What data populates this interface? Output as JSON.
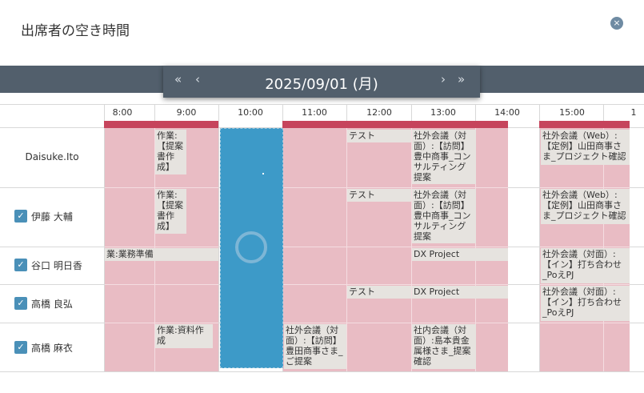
{
  "dialog": {
    "title": "出席者の空き時間",
    "close_icon": "×"
  },
  "nav": {
    "prev_week": "«",
    "prev_day": "‹",
    "date": "2025/09/01 (月)",
    "next_day": "›",
    "next_week": "»"
  },
  "times": [
    "8:00",
    "9:00",
    "10:00",
    "11:00",
    "12:00",
    "13:00",
    "14:00",
    "15:00",
    "1"
  ],
  "members": [
    {
      "name": "Daisuke.Ito",
      "checked": false
    },
    {
      "name": "伊藤 大輔",
      "checked": true
    },
    {
      "name": "谷口 明日香",
      "checked": true
    },
    {
      "name": "高橋 良弘",
      "checked": true
    },
    {
      "name": "高橋 麻衣",
      "checked": true
    }
  ],
  "check_mark": "✓",
  "events": {
    "e1": "作業:【提案書作成】",
    "e2": "テスト",
    "e3": "社外会議（対面）:【訪問】豊中商事_コンサルティング提案",
    "e4": "社外会議（Web）:【定例】山田商事さま_プロジェクト確認",
    "e5": "作業:【提案書作成】",
    "e6": "テスト",
    "e7": "社外会議（対面）:【訪問】豊中商事_コンサルティング提案",
    "e8": "社外会議（Web）:【定例】山田商事さま_プロジェクト確認",
    "e9": "業:業務準備",
    "e10": "DX Project",
    "e11": "社外会議（対面）:【イン】打ち合わせ_PoえPJ",
    "e12": "テスト",
    "e13": "DX Project",
    "e14": "社外会議（対面）:【イン】打ち合わせ_PoえPJ",
    "e15": "作業:資料作成",
    "e16": "社外会議（対面）:【訪問】豊田商事さま_ご提案",
    "e17": "社内会議（対面）:島本貴金属様さま_提案確認"
  }
}
